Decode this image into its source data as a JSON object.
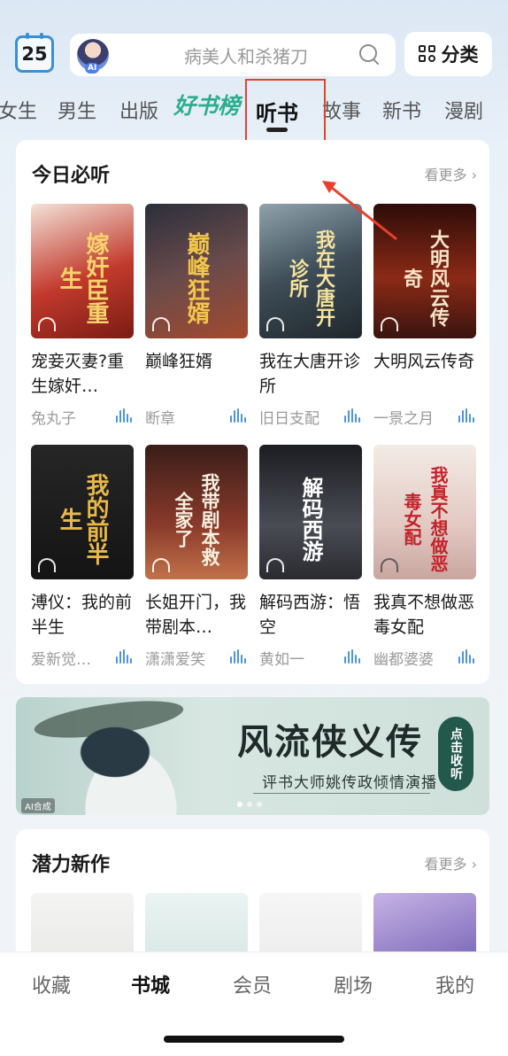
{
  "header": {
    "calendar_day": "25",
    "search_placeholder": "病美人和杀猪刀",
    "ai_badge": "AI",
    "category_label": "分类"
  },
  "tabs": [
    {
      "label": "女生"
    },
    {
      "label": "男生"
    },
    {
      "label": "出版"
    },
    {
      "label": "好书榜"
    },
    {
      "label": "听书"
    },
    {
      "label": "故事"
    },
    {
      "label": "新书"
    },
    {
      "label": "漫剧"
    }
  ],
  "section1": {
    "title": "今日必听",
    "more": "看更多",
    "books": [
      {
        "cover_text": "嫁奸臣重生",
        "title": "宠妾灭妻?重生嫁奸…",
        "author": "兔丸子",
        "bg": "#b33a2c"
      },
      {
        "cover_text": "巅峰狂婿",
        "title": "巅峰狂婿",
        "author": "断章",
        "bg": "#4b3b4a"
      },
      {
        "cover_text": "我在大唐开诊所",
        "title": "我在大唐开诊所",
        "author": "旧日支配",
        "bg": "#3a4b52"
      },
      {
        "cover_text": "大明风云传奇",
        "title": "大明风云传奇",
        "author": "一景之月",
        "bg": "#5c1b12"
      },
      {
        "cover_text": "我的前半生",
        "title": "溥仪：我的前半生",
        "author": "爱新觉…",
        "bg": "#1e1e1e"
      },
      {
        "cover_text": "我带剧本救全家了",
        "title": "长姐开门，我带剧本…",
        "author": "潇潇爱笑",
        "bg": "#5a2a24"
      },
      {
        "cover_text": "解码西游",
        "title": "解码西游：悟空",
        "author": "黄如一",
        "bg": "#2e3036"
      },
      {
        "cover_text": "我真不想做恶毒女配",
        "title": "我真不想做恶毒女配",
        "author": "幽都婆婆",
        "bg": "#e8dcd6"
      }
    ]
  },
  "banner": {
    "title": "风流侠义传",
    "subtitle": "评书大师姚传政倾情演播",
    "tag": "点击收听",
    "ai_label": "AI合成"
  },
  "section2": {
    "title": "潜力新作",
    "more": "看更多"
  },
  "bottom_nav": [
    {
      "label": "收藏"
    },
    {
      "label": "书城"
    },
    {
      "label": "会员"
    },
    {
      "label": "剧场"
    },
    {
      "label": "我的"
    }
  ],
  "colors": {
    "annotation_red": "#e8402d",
    "wave_blue": "#4a95e0",
    "accent_green": "#2cae8e"
  }
}
